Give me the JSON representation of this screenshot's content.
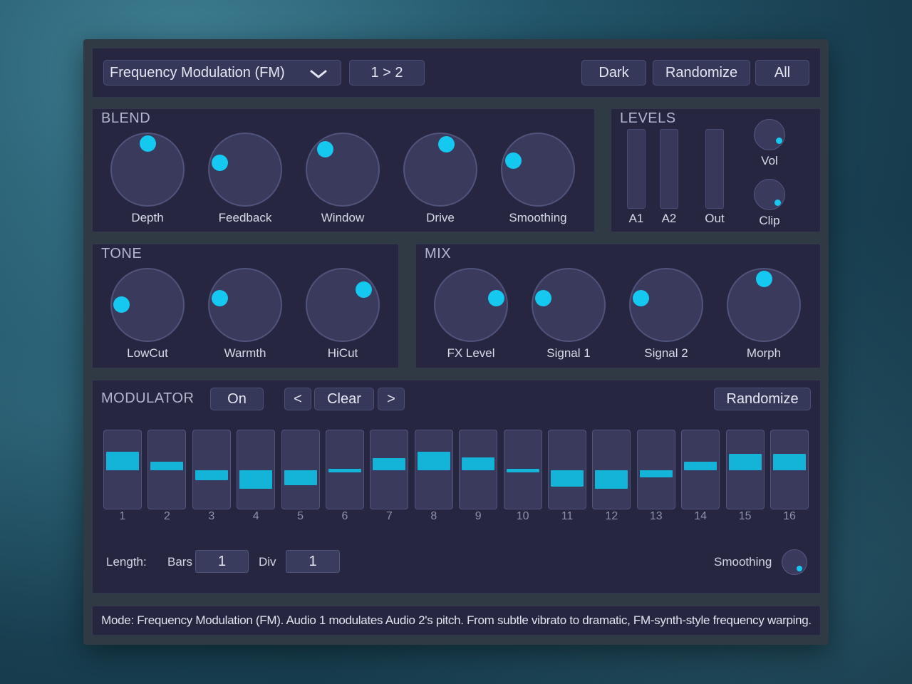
{
  "header": {
    "mode_select": "Frequency Modulation (FM)",
    "routing_button": "1 > 2",
    "theme_button": "Dark",
    "randomize_button": "Randomize",
    "all_button": "All"
  },
  "blend": {
    "title": "BLEND",
    "knobs": [
      {
        "label": "Depth",
        "value": 0.5
      },
      {
        "label": "Feedback",
        "value": 0.22
      },
      {
        "label": "Window",
        "value": 0.35
      },
      {
        "label": "Drive",
        "value": 0.55
      },
      {
        "label": "Smoothing",
        "value": 0.24
      }
    ]
  },
  "levels": {
    "title": "LEVELS",
    "meters": [
      {
        "label": "A1",
        "value": 0
      },
      {
        "label": "A2",
        "value": 0
      },
      {
        "label": "Out",
        "value": 0
      }
    ],
    "vol_label": "Vol",
    "clip_label": "Clip"
  },
  "tone": {
    "title": "TONE",
    "knobs": [
      {
        "label": "LowCut",
        "value": 0.17
      },
      {
        "label": "Warmth",
        "value": 0.22
      },
      {
        "label": "HiCut",
        "value": 0.7
      }
    ]
  },
  "mix": {
    "title": "MIX",
    "knobs": [
      {
        "label": "FX Level",
        "value": 0.78
      },
      {
        "label": "Signal 1",
        "value": 0.22
      },
      {
        "label": "Signal 2",
        "value": 0.22
      },
      {
        "label": "Morph",
        "value": 0.5
      }
    ]
  },
  "modulator": {
    "title": "MODULATOR",
    "on_button": "On",
    "prev_button": "<",
    "clear_button": "Clear",
    "next_button": ">",
    "randomize_button": "Randomize",
    "steps": [
      {
        "num": "1",
        "value": 0.5
      },
      {
        "num": "2",
        "value": 0.08
      },
      {
        "num": "3",
        "value": -0.27
      },
      {
        "num": "4",
        "value": -0.5
      },
      {
        "num": "5",
        "value": -0.41
      },
      {
        "num": "6",
        "value": 0
      },
      {
        "num": "7",
        "value": 0.32
      },
      {
        "num": "8",
        "value": 0.5
      },
      {
        "num": "9",
        "value": 0.34
      },
      {
        "num": "10",
        "value": 0
      },
      {
        "num": "11",
        "value": -0.45
      },
      {
        "num": "12",
        "value": -0.5
      },
      {
        "num": "13",
        "value": -0.2
      },
      {
        "num": "14",
        "value": 0.08
      },
      {
        "num": "15",
        "value": 0.45
      },
      {
        "num": "16",
        "value": 0.45
      }
    ],
    "length_label": "Length:",
    "bars_label": "Bars",
    "bars_value": "1",
    "div_label": "Div",
    "div_value": "1",
    "smoothing_label": "Smoothing"
  },
  "status": {
    "text": "Mode: Frequency Modulation (FM). Audio 1 modulates Audio 2's pitch. From subtle vibrato to dramatic, FM-synth-style frequency warping."
  },
  "colors": {
    "accent": "#14c8f0",
    "panel": "#262640",
    "control": "#3a3b5c"
  }
}
